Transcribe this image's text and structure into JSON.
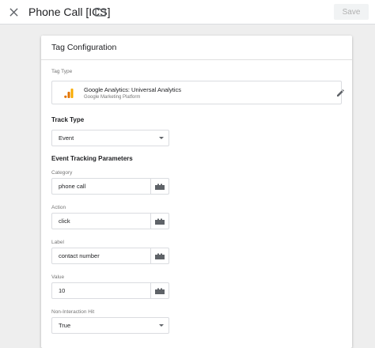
{
  "header": {
    "title": "Phone Call [ICS]",
    "save_label": "Save",
    "close_icon": "close-icon",
    "folder_icon": "folder-icon"
  },
  "card": {
    "title": "Tag Configuration",
    "tag_type": {
      "label": "Tag Type",
      "name": "Google Analytics: Universal Analytics",
      "provider": "Google Marketing Platform",
      "icon": "google-analytics-icon",
      "edit_icon": "pencil-icon"
    },
    "track_type": {
      "label": "Track Type",
      "value": "Event"
    },
    "event_params": {
      "title": "Event Tracking Parameters",
      "category": {
        "label": "Category",
        "value": "phone call"
      },
      "action": {
        "label": "Action",
        "value": "click"
      },
      "label": {
        "label": "Label",
        "value": "contact number"
      },
      "value": {
        "label": "Value",
        "value": "10"
      },
      "non_interaction": {
        "label": "Non-Interaction Hit",
        "value": "True"
      }
    },
    "variable_icon": "variable-block-icon"
  },
  "colors": {
    "ga_orange": "#F9AB00",
    "ga_dark_orange": "#E37400",
    "icon_gray": "#5f6368",
    "border": "#dadce0",
    "background": "#eeeeee"
  }
}
